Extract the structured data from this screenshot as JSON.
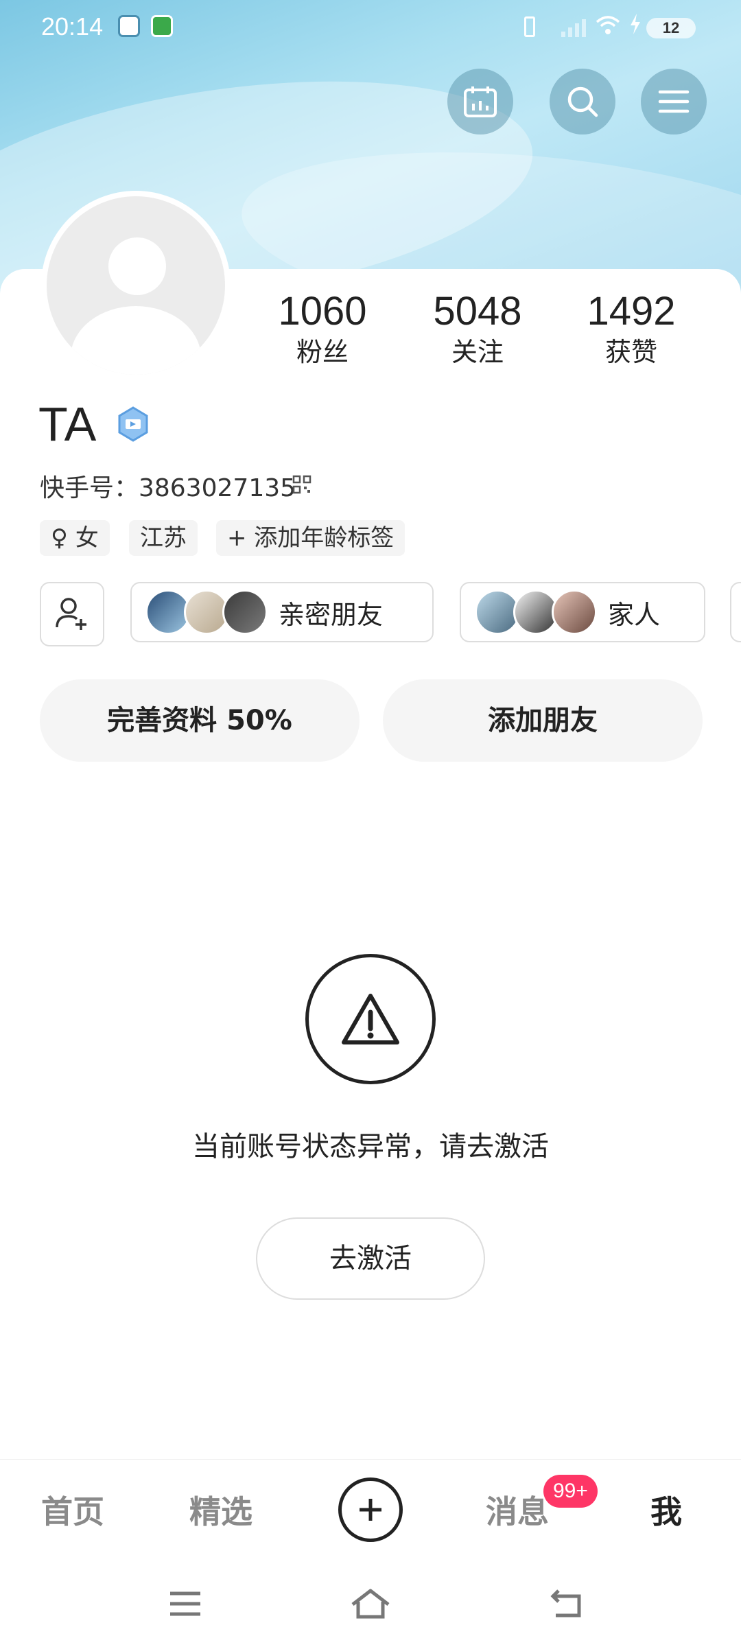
{
  "status_bar": {
    "time": "20:14",
    "battery": "12"
  },
  "header": {
    "icons": [
      "calendar-icon",
      "search-icon",
      "menu-icon"
    ]
  },
  "profile": {
    "name": "TA",
    "kuaishou_id": "快手号：3863027135",
    "stats": [
      {
        "value": "1060",
        "label": "粉丝"
      },
      {
        "value": "5048",
        "label": "关注"
      },
      {
        "value": "1492",
        "label": "获赞"
      }
    ],
    "tags": [
      "♀ 女",
      "江苏",
      "+ 添加年龄标签"
    ]
  },
  "circles": [
    {
      "label": "亲密朋友"
    },
    {
      "label": "家人"
    }
  ],
  "actions": {
    "complete_profile": "完善资料 50%",
    "add_friends": "添加朋友"
  },
  "notice": {
    "message": "当前账号状态异常，请去激活",
    "button": "去激活"
  },
  "bottom_nav": {
    "items": [
      "首页",
      "精选",
      "消息",
      "我"
    ],
    "message_badge": "99+",
    "active": "我"
  },
  "colors": {
    "accent_badge": "#fe3666",
    "header_sky": "#9fd7ee"
  }
}
